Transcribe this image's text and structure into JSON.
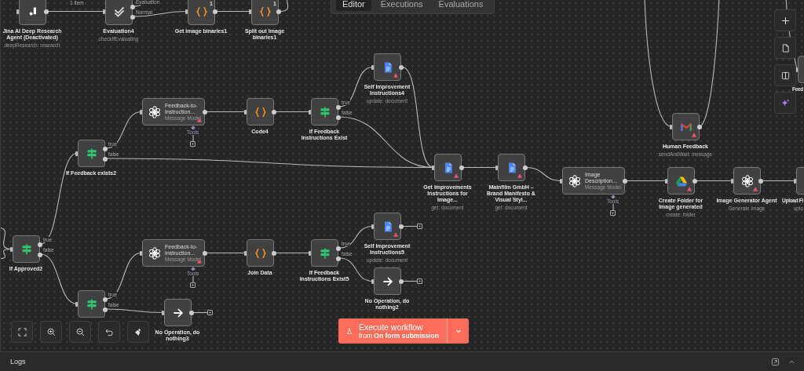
{
  "tabs": [
    {
      "label": "Editor",
      "selected": true
    },
    {
      "label": "Executions",
      "selected": false
    },
    {
      "label": "Evaluations",
      "selected": false
    }
  ],
  "nodes": [
    {
      "kind": "jina",
      "title": "Jina AI Deep Research Agent (Deactivated)",
      "subtitle": "deepResearch: research",
      "warning": false,
      "edge_label": "1 item"
    },
    {
      "kind": "evaluation",
      "title": "Evaluation4",
      "subtitle": "checkIfEvaluating",
      "warning": false,
      "outputs": [
        "Evaluation",
        "Normal"
      ]
    },
    {
      "kind": "code",
      "title": "Get image binaries1",
      "warning": false,
      "badge": "1"
    },
    {
      "kind": "code",
      "title": "Split out Image binaries1",
      "warning": false,
      "badge": "1"
    },
    {
      "kind": "docs",
      "title": "Self Improvement Instructions4",
      "subtitle": "update: document",
      "warning": true
    },
    {
      "kind": "model",
      "title": "Feedback-to-Instruction...",
      "subtitle": "Message Model",
      "warning": true,
      "tools": "Tools"
    },
    {
      "kind": "code",
      "title": "Code4",
      "warning": false
    },
    {
      "kind": "if",
      "title": "If Feedback Instructions Exist",
      "warning": false,
      "outputs": [
        "true",
        "false"
      ]
    },
    {
      "kind": "if",
      "title": "If Feedback exists2",
      "warning": false,
      "outputs": [
        "true",
        "false"
      ]
    },
    {
      "kind": "docs",
      "title": "Get Improvements Instructions for Image...",
      "subtitle": "get: document",
      "warning": true
    },
    {
      "kind": "docs",
      "title": "Mainfilm GmbH – Brand Manifesto & Visual Styl...",
      "subtitle": "get: document",
      "warning": true
    },
    {
      "kind": "model",
      "title": "Image Description...",
      "subtitle": "Message Model",
      "warning": false,
      "tools": "Tools"
    },
    {
      "kind": "gmail",
      "title": "Human Feedback",
      "subtitle": "sendAndWait: message",
      "warning": true
    },
    {
      "kind": "drive",
      "title": "Create Folder for Image generated",
      "subtitle": "create: folder",
      "warning": true
    },
    {
      "kind": "openai",
      "title": "Image Generator Agent",
      "subtitle": "Generate Image",
      "warning": true
    },
    {
      "kind": "drive",
      "title": "Feed",
      "warning": false
    },
    {
      "kind": "drive",
      "title": "Upload Fi",
      "subtitle": "uplo",
      "warning": false
    },
    {
      "kind": "if",
      "title": "If Approved2",
      "warning": false,
      "outputs": [
        "true",
        "false"
      ]
    },
    {
      "kind": "model",
      "title": "Feedback-to-Instruction...",
      "subtitle": "Message Model",
      "warning": true,
      "tools": "Tools"
    },
    {
      "kind": "code",
      "title": "Join Data",
      "warning": false
    },
    {
      "kind": "if",
      "title": "If Feedback Instructions Exist5",
      "warning": false,
      "outputs": [
        "true",
        "false"
      ]
    },
    {
      "kind": "docs",
      "title": "Self Improvement Instructions5",
      "subtitle": "update: document",
      "warning": true
    },
    {
      "kind": "noop",
      "title": "No Operation, do nothing2",
      "warning": false
    },
    {
      "kind": "if",
      "warning": false,
      "outputs": [
        "true",
        "false"
      ]
    },
    {
      "kind": "noop",
      "title": "No Operation, do nothing3",
      "warning": false
    }
  ],
  "execute_button": {
    "title": "Execute workflow",
    "subtitle": "from **On form submission**"
  },
  "logs_panel": {
    "title": "Logs"
  }
}
